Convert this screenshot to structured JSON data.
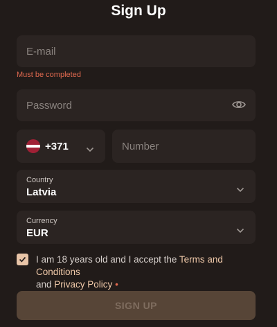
{
  "page": {
    "title": "Sign Up"
  },
  "email": {
    "placeholder": "E-mail",
    "error": "Must be completed"
  },
  "password": {
    "placeholder": "Password",
    "icon": "eye-icon"
  },
  "phone": {
    "flag": "latvia-flag-icon",
    "dial_code": "+371",
    "number_placeholder": "Number"
  },
  "country": {
    "label": "Country",
    "value": "Latvia"
  },
  "currency": {
    "label": "Currency",
    "value": "EUR"
  },
  "agreement": {
    "checked": true,
    "text_before": "I am 18 years old and I accept the ",
    "terms_link": "Terms and Conditions",
    "and": "and ",
    "privacy_link": "Privacy Policy",
    "required_mark": "•"
  },
  "submit": {
    "label": "SIGN UP"
  },
  "colors": {
    "accent": "#e8c4a7",
    "error": "#e0694f",
    "background": "#211b19",
    "field": "#2b2422"
  }
}
